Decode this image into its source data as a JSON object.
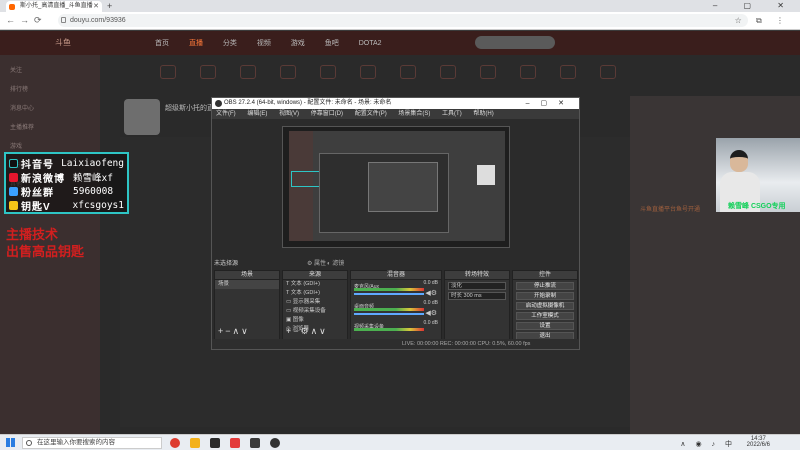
{
  "browser": {
    "tab_title": "斯小托_高清直播_斗鱼直播",
    "url": "douyu.com/93936",
    "new_tab": "+",
    "window_controls": "– ▢ ✕"
  },
  "douyu": {
    "logo": "斗鱼",
    "nav": [
      "首页",
      "直播",
      "分类",
      "视频",
      "游戏",
      "鱼吧",
      "DOTA2"
    ],
    "nav_current": "直播",
    "sidebar": [
      "关注",
      "排行榜",
      "消息中心",
      "主播推荐",
      "游戏",
      "娱乐",
      "其他"
    ],
    "streamer_name": "超级斯小托的直播",
    "hot_text": "斗鱼直播平台鱼号开通"
  },
  "social": {
    "rows": [
      {
        "label": "抖音号",
        "value": "Laixiaofeng",
        "icon_color": "#111111"
      },
      {
        "label": "新浪微博",
        "value": "赖雪峰xf",
        "icon_color": "#e6162d"
      },
      {
        "label": "粉丝群",
        "value": "5960008",
        "icon_color": "#3aa0ff"
      },
      {
        "label": "钥匙V",
        "value": "xfcsgoys1",
        "icon_color": "#f5c518"
      }
    ]
  },
  "red_text": {
    "line1": "主播技术",
    "line2": "出售高品钥匙"
  },
  "webcam": {
    "text": "赖雪峰 CSGO专用"
  },
  "obs": {
    "title": "OBS 27.2.4 (64-bit, windows) - 配置文件: 未命名 - 场景: 未命名",
    "menu": [
      "文件(F)",
      "编辑(E)",
      "视图(V)",
      "停靠窗口(D)",
      "配置文件(P)",
      "场景集合(S)",
      "工具(T)",
      "帮助(H)"
    ],
    "no_source": "未选择源",
    "props": "⚙ 属性",
    "filters": "◐ 滤镜",
    "scenes_header": "场景",
    "scene_name": "场景",
    "sources_header": "来源",
    "sources": [
      "文本 (GDI+)",
      "文本 (GDI+)",
      "显示器采集",
      "视频采集设备",
      "图像",
      "浏览器"
    ],
    "mixer_header": "混音器",
    "mixer": [
      {
        "name": "麦克风/Aux",
        "level": "0.0 dB"
      },
      {
        "name": "桌面音频",
        "level": "0.0 dB"
      },
      {
        "name": "视频采集设备",
        "level": "0.0 dB"
      }
    ],
    "transition_header": "转场特效",
    "transition": "淡化",
    "duration_label": "时长",
    "duration": "300 ms",
    "controls_header": "控件",
    "controls": [
      "停止推流",
      "开始录制",
      "启动虚拟摄像机",
      "工作室模式",
      "设置",
      "退出"
    ],
    "status": "LIVE: 00:00:00   REC: 00:00:00   CPU: 0.5%, 60.00 fps"
  },
  "taskbar": {
    "search_placeholder": "在这里输入你要搜索的内容",
    "time": "14:37",
    "date": "2022/6/6",
    "app_colors": [
      "#dd3c2f",
      "#f3b11b",
      "#2b2b2b",
      "#e33b3b",
      "#3a3a3a",
      "#333333"
    ]
  }
}
